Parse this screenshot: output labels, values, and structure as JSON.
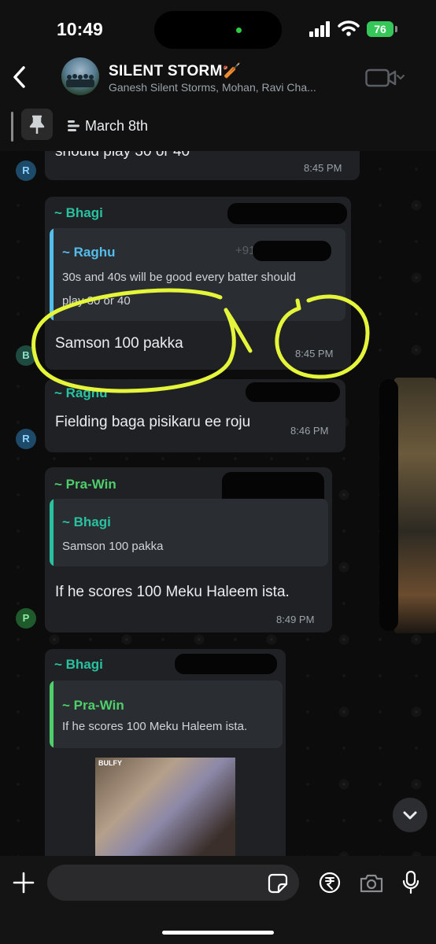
{
  "status_bar": {
    "time": "10:49",
    "battery": "76"
  },
  "header": {
    "title": "SILENT STORM🏏",
    "subtitle": "Ganesh Silent Storms, Mohan, Ravi Cha..."
  },
  "pinned": {
    "date": "March 8th"
  },
  "messages": [
    {
      "avatar": "R",
      "text": "should play 30 or 40",
      "time": "8:45 PM"
    },
    {
      "avatar": "B",
      "sender": "~ Bhagi",
      "quote_sender": "~ Raghu",
      "quote_phone": "+91 ...6",
      "quote_line1": "30s and 40s will be good every batter should",
      "quote_line2": "play 30 or 40",
      "text": "Samson 100 pakka",
      "time": "8:45 PM"
    },
    {
      "avatar": "R",
      "sender": "~ Raghu",
      "text": "Fielding baga pisikaru ee roju",
      "time": "8:46 PM"
    },
    {
      "avatar": "P",
      "sender": "~ Pra-Win",
      "quote_sender": "~ Bhagi",
      "quote_text": "Samson 100 pakka",
      "text": "If he scores 100 Meku Haleem ista.",
      "time": "8:49 PM"
    },
    {
      "sender": "~ Bhagi",
      "quote_sender": "~ Pra-Win",
      "quote_text": "If he scores 100 Meku Haleem ista.",
      "media_label": "BULFY"
    }
  ],
  "colors": {
    "accent_green": "#4fcf6c",
    "highlight": "#e4f53a",
    "quote_teal": "#29c2a0",
    "quote_blue": "#53bdeb"
  },
  "icons": [
    "back-chevron-icon",
    "video-call-icon",
    "pin-icon",
    "scroll-down-icon",
    "plus-icon",
    "sticker-icon",
    "rupee-icon",
    "camera-icon",
    "microphone-icon"
  ]
}
